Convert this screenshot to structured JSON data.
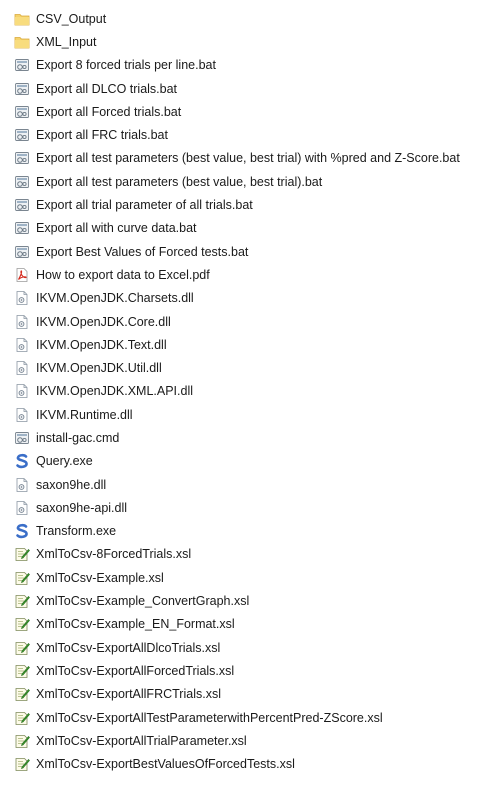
{
  "files": [
    {
      "name": "CSV_Output",
      "icon": "folder-icon"
    },
    {
      "name": "XML_Input",
      "icon": "folder-icon"
    },
    {
      "name": "Export 8 forced trials per line.bat",
      "icon": "batch-file-icon"
    },
    {
      "name": "Export all DLCO trials.bat",
      "icon": "batch-file-icon"
    },
    {
      "name": "Export all Forced trials.bat",
      "icon": "batch-file-icon"
    },
    {
      "name": "Export all FRC trials.bat",
      "icon": "batch-file-icon"
    },
    {
      "name": "Export all test parameters (best value, best trial) with %pred and Z-Score.bat",
      "icon": "batch-file-icon"
    },
    {
      "name": "Export all test parameters (best value, best trial).bat",
      "icon": "batch-file-icon"
    },
    {
      "name": "Export all trial parameter of all trials.bat",
      "icon": "batch-file-icon"
    },
    {
      "name": "Export all with curve data.bat",
      "icon": "batch-file-icon"
    },
    {
      "name": "Export Best Values of Forced tests.bat",
      "icon": "batch-file-icon"
    },
    {
      "name": "How to export data to Excel.pdf",
      "icon": "pdf-file-icon"
    },
    {
      "name": "IKVM.OpenJDK.Charsets.dll",
      "icon": "dll-file-icon"
    },
    {
      "name": "IKVM.OpenJDK.Core.dll",
      "icon": "dll-file-icon"
    },
    {
      "name": "IKVM.OpenJDK.Text.dll",
      "icon": "dll-file-icon"
    },
    {
      "name": "IKVM.OpenJDK.Util.dll",
      "icon": "dll-file-icon"
    },
    {
      "name": "IKVM.OpenJDK.XML.API.dll",
      "icon": "dll-file-icon"
    },
    {
      "name": "IKVM.Runtime.dll",
      "icon": "dll-file-icon"
    },
    {
      "name": "install-gac.cmd",
      "icon": "batch-file-icon"
    },
    {
      "name": "Query.exe",
      "icon": "saxon-exe-icon"
    },
    {
      "name": "saxon9he.dll",
      "icon": "dll-file-icon"
    },
    {
      "name": "saxon9he-api.dll",
      "icon": "dll-file-icon"
    },
    {
      "name": "Transform.exe",
      "icon": "saxon-exe-icon"
    },
    {
      "name": "XmlToCsv-8ForcedTrials.xsl",
      "icon": "xsl-file-icon"
    },
    {
      "name": "XmlToCsv-Example.xsl",
      "icon": "xsl-file-icon"
    },
    {
      "name": "XmlToCsv-Example_ConvertGraph.xsl",
      "icon": "xsl-file-icon"
    },
    {
      "name": "XmlToCsv-Example_EN_Format.xsl",
      "icon": "xsl-file-icon"
    },
    {
      "name": "XmlToCsv-ExportAllDlcoTrials.xsl",
      "icon": "xsl-file-icon"
    },
    {
      "name": "XmlToCsv-ExportAllForcedTrials.xsl",
      "icon": "xsl-file-icon"
    },
    {
      "name": "XmlToCsv-ExportAllFRCTrials.xsl",
      "icon": "xsl-file-icon"
    },
    {
      "name": "XmlToCsv-ExportAllTestParameterwithPercentPred-ZScore.xsl",
      "icon": "xsl-file-icon"
    },
    {
      "name": "XmlToCsv-ExportAllTrialParameter.xsl",
      "icon": "xsl-file-icon"
    },
    {
      "name": "XmlToCsv-ExportBestValuesOfForcedTests.xsl",
      "icon": "xsl-file-icon"
    }
  ]
}
